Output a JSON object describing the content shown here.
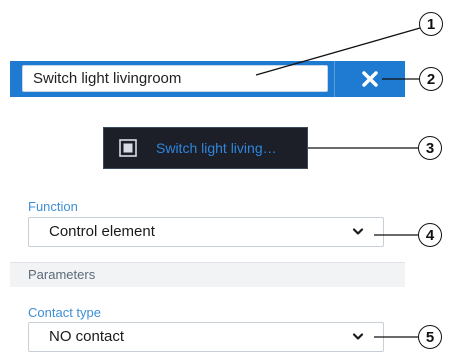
{
  "colors": {
    "accent": "#1f7ad1",
    "tile_background": "#1c1f27",
    "tile_label": "#2e86de",
    "field_label": "#3f8fd6"
  },
  "header": {
    "name_value": "Switch light livingroom",
    "close_icon": "close-icon"
  },
  "preview": {
    "icon": "square-icon",
    "label": "Switch light living…"
  },
  "function_field": {
    "label": "Function",
    "value": "Control element",
    "icon": "chevron-down-icon"
  },
  "parameters": {
    "label": "Parameters"
  },
  "contact_field": {
    "label": "Contact type",
    "value": "NO contact",
    "icon": "chevron-down-icon"
  },
  "callouts": [
    "1",
    "2",
    "3",
    "4",
    "5"
  ]
}
